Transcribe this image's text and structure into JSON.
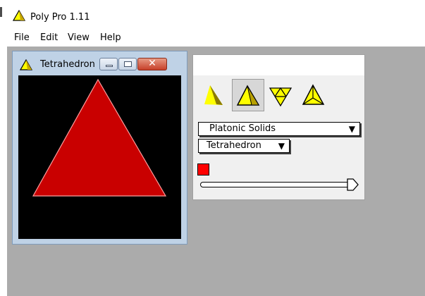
{
  "app": {
    "title": "Poly Pro 1.11"
  },
  "menu": {
    "items": [
      "File",
      "Edit",
      "View",
      "Help"
    ]
  },
  "child_window": {
    "title": "Tetrahedron",
    "close_glyph": "✕"
  },
  "control_panel": {
    "view_buttons": [
      "solid-view",
      "shaded-view",
      "net-view",
      "vertex-view"
    ],
    "category_select": {
      "value": "Platonic Solids",
      "arrow": "▼"
    },
    "polyhedron_select": {
      "value": "Tetrahedron",
      "arrow": "▼"
    },
    "color": "#ff0000",
    "slider": {
      "value_fraction": 1.0
    }
  },
  "colors": {
    "face": "#c90000",
    "canvas_bg": "#000000",
    "workspace": "#ababab",
    "icon_yellow": "#ffff00"
  }
}
